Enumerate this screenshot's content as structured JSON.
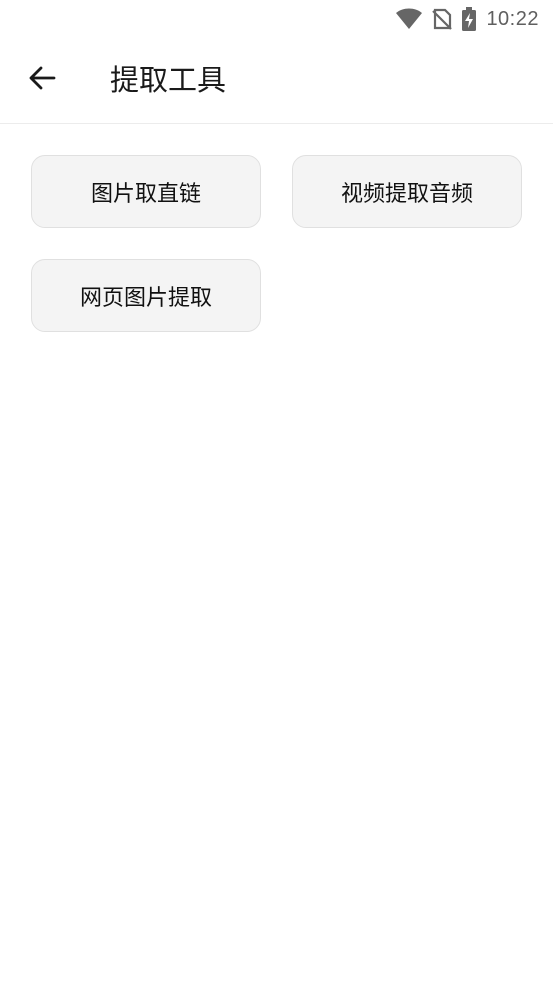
{
  "status_bar": {
    "time": "10:22",
    "icons": [
      "wifi-icon",
      "no-sim-icon",
      "battery-charging-icon"
    ]
  },
  "app_bar": {
    "back_icon": "arrow-left-icon",
    "title": "提取工具"
  },
  "tools": [
    {
      "label": "图片取直链"
    },
    {
      "label": "视频提取音频"
    },
    {
      "label": "网页图片提取"
    }
  ]
}
